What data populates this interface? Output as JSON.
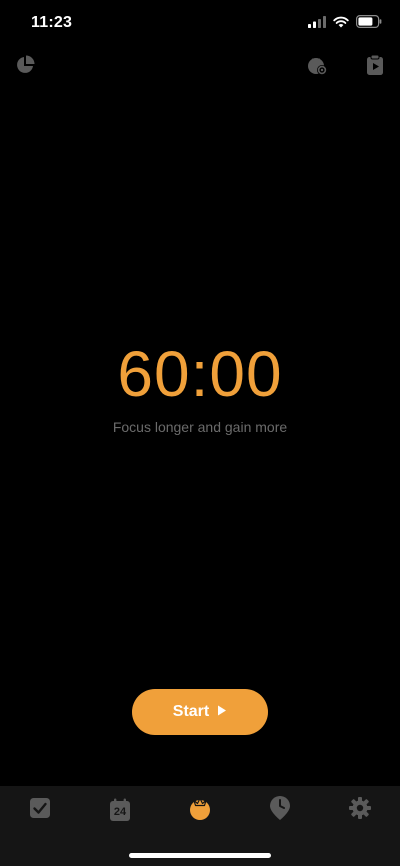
{
  "status_bar": {
    "time": "11:23",
    "icons": [
      "cellular-signal-icon",
      "wifi-icon",
      "battery-icon"
    ]
  },
  "toolbar": {
    "left_icon": "stats-pie-icon",
    "right_icons": [
      "tomato-settings-icon",
      "clipboard-play-icon"
    ]
  },
  "timer": {
    "display": "60:00",
    "subtitle": "Focus longer and gain more"
  },
  "start_button": {
    "label": "Start"
  },
  "tab_bar": {
    "items": [
      {
        "icon": "checkbox-icon"
      },
      {
        "icon": "calendar-icon",
        "text": "24"
      },
      {
        "icon": "tomato-icon",
        "active": true
      },
      {
        "icon": "clock-pin-icon"
      },
      {
        "icon": "gear-icon"
      }
    ]
  },
  "colors": {
    "accent": "#F0A03A",
    "background": "#000000",
    "tab_background": "#151515",
    "icon_inactive": "#5a5a5a",
    "subtitle": "#6b6b6b"
  }
}
